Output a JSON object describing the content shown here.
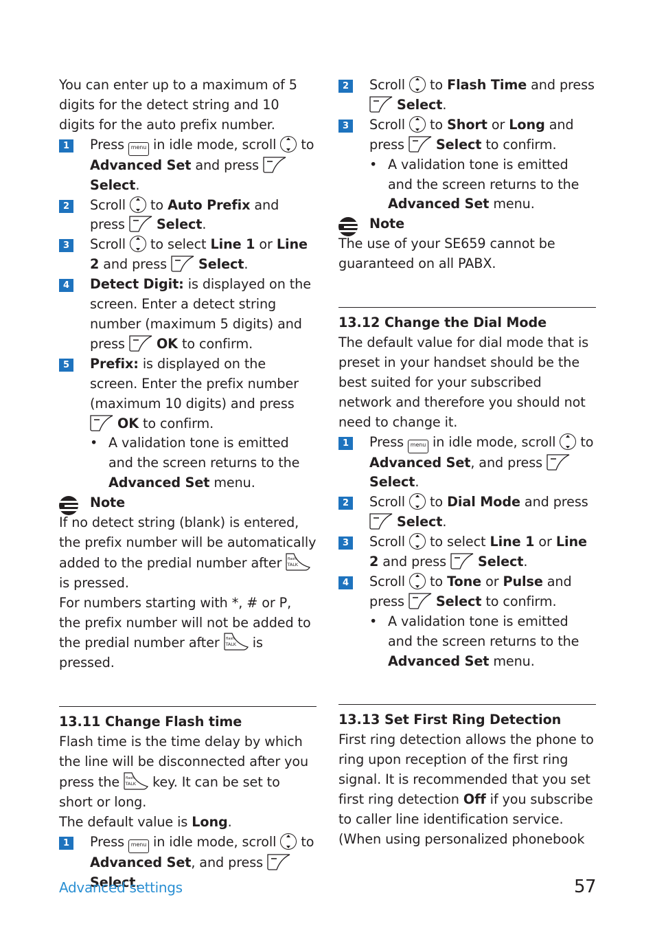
{
  "page": {
    "footer_section": "Advanced settings",
    "page_number": "57"
  },
  "icons": {
    "menu_label": "menu",
    "nav_top": "call ID",
    "nav_bottom": "Ph.Book",
    "talk_top": "flash",
    "talk_bottom": "TALK"
  },
  "left": {
    "intro": "You can enter up to a maximum of 5 digits for the detect string and 10 digits for the auto prefix number.",
    "steps": [
      {
        "num": "1",
        "t1": "Press",
        "t2": "in idle mode, scroll",
        "t3": "to",
        "b1": "Advanced Set",
        "t4": "and press",
        "b2": "Select",
        "t5": "."
      },
      {
        "num": "2",
        "t1": "Scroll",
        "t2": "to",
        "b1": "Auto Prefix",
        "t3": "and press",
        "b2": "Select",
        "t4": "."
      },
      {
        "num": "3",
        "t1": "Scroll",
        "t2": "to select",
        "b1": "Line 1",
        "t3": "or",
        "b2": "Line 2",
        "t4": "and press",
        "b3": "Select",
        "t5": "."
      },
      {
        "num": "4",
        "b1": "Detect Digit:",
        "t1": "is displayed on the screen. Enter a detect string number (maximum 5 digits) and press",
        "b2": "OK",
        "t2": "to confirm."
      },
      {
        "num": "5",
        "b1": "Prefix:",
        "t1": "is displayed on the screen. Enter the prefix number (maximum 10 digits) and press",
        "b2": "OK",
        "t2": "to confirm."
      }
    ],
    "bullet": {
      "t1": "A validation tone is emitted and the screen returns to the",
      "b1": "Advanced Set",
      "t2": "menu."
    },
    "note": {
      "title": "Note",
      "p1a": "If no detect string (blank) is entered, the prefix number will be automatically added to the predial number after",
      "p1b": "is pressed.",
      "p2a": "For numbers starting with *, # or P, the prefix number will not be added to the predial number after",
      "p2b": "is pressed."
    },
    "section": {
      "num": "13.11",
      "title": "Change Flash time",
      "p1a": "Flash time is the time delay by which the line will be disconnected after you press the",
      "p1b": "key. It can be set to short or long.",
      "p2a": "The default value is",
      "p2b": "Long",
      "p2c": ".",
      "step1": {
        "num": "1",
        "t1": "Press",
        "t2": "in idle mode, scroll",
        "t3": "to",
        "b1": "Advanced Set",
        "t4": ", and press",
        "b2": "Select",
        "t5": "."
      }
    }
  },
  "right": {
    "steps": [
      {
        "num": "2",
        "t1": "Scroll",
        "t2": "to",
        "b1": "Flash Time",
        "t3": "and press",
        "b2": "Select",
        "t4": "."
      },
      {
        "num": "3",
        "t1": "Scroll",
        "t2": "to",
        "b1": "Short",
        "t3": "or",
        "b2": "Long",
        "t4": "and press",
        "b3": "Select",
        "t5": "to confirm."
      }
    ],
    "bullet": {
      "t1": "A validation tone is emitted and the screen returns to the",
      "b1": "Advanced Set",
      "t2": "menu."
    },
    "note": {
      "title": "Note",
      "text": "The use of your SE659 cannot be guaranteed on all PABX."
    },
    "section12": {
      "num": "13.12",
      "title": "Change the Dial Mode",
      "intro": "The default value for dial mode that is preset in your handset should be the best suited for your subscribed network and therefore you should not need to change it.",
      "steps": [
        {
          "num": "1",
          "t1": "Press",
          "t2": "in idle mode, scroll",
          "t3": "to",
          "b1": "Advanced Set",
          "t4": ", and press",
          "b2": "Select",
          "t5": "."
        },
        {
          "num": "2",
          "t1": "Scroll",
          "t2": "to",
          "b1": "Dial Mode",
          "t3": "and press",
          "b2": "Select",
          "t4": "."
        },
        {
          "num": "3",
          "t1": "Scroll",
          "t2": "to select",
          "b1": "Line 1",
          "t3": "or",
          "b2": "Line 2",
          "t4": "and press",
          "b3": "Select",
          "t5": "."
        },
        {
          "num": "4",
          "t1": "Scroll",
          "t2": "to",
          "b1": "Tone",
          "t3": "or",
          "b2": "Pulse",
          "t4": "and press",
          "b3": "Select",
          "t5": "to confirm."
        }
      ],
      "bullet": {
        "t1": "A validation tone is emitted and the screen returns to the",
        "b1": "Advanced Set",
        "t2": "menu."
      }
    },
    "section13": {
      "num": "13.13",
      "title": "Set First Ring Detection",
      "p1a": "First ring detection allows the phone to ring upon reception of the first ring signal. It is recommended that you set first ring detection",
      "p1b": "Off",
      "p1c": "if you subscribe to caller line identification service. (When using personalized phonebook"
    }
  }
}
